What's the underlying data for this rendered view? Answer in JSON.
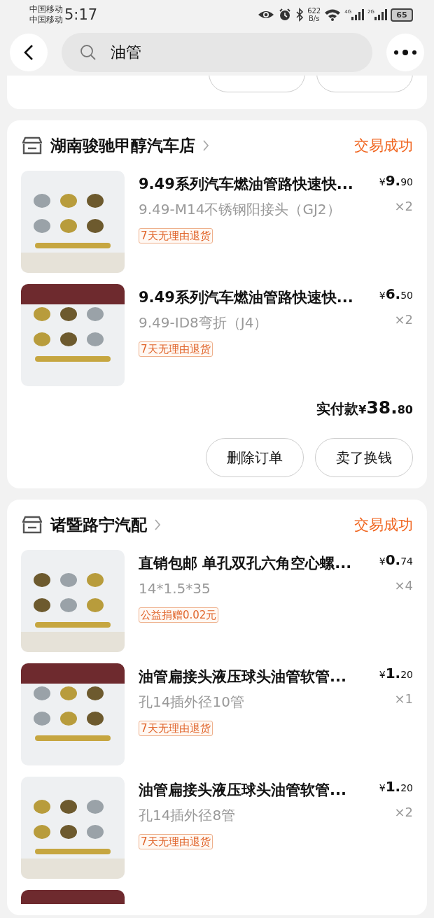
{
  "status_bar": {
    "carriers": [
      "中国移动",
      "中国移动"
    ],
    "time": "5:17",
    "net_speed": [
      "622",
      "B/s"
    ],
    "signals": [
      "4G",
      "2G"
    ],
    "battery": "65"
  },
  "search": {
    "value": "油管"
  },
  "orders": [
    {
      "store": "湖南骏驰甲醇汽车店",
      "status": "交易成功",
      "items": [
        {
          "kind": "item",
          "title": "9.49系列汽车燃油管路快速快...",
          "spec": "9.49-M14不锈钢阳接头（GJ2）",
          "tag": "7天无理由退货",
          "price_symbol": "¥",
          "price_main": "9.",
          "price_fraction": "90",
          "quantity": "×2"
        },
        {
          "kind": "item",
          "title": "9.49系列汽车燃油管路快速快...",
          "spec": "9.49-ID8弯折（J4）",
          "tag": "7天无理由退货",
          "price_symbol": "¥",
          "price_main": "6.",
          "price_fraction": "50",
          "quantity": "×2"
        }
      ],
      "total": {
        "label": "实付款",
        "price_symbol": "¥",
        "price_main": "38.",
        "price_fraction": "80"
      },
      "buttons": [
        "删除订单",
        "卖了换钱"
      ]
    },
    {
      "store": "诸暨路宁汽配",
      "status": "交易成功",
      "items": [
        {
          "kind": "item",
          "title": "直销包邮 单孔双孔六角空心螺...",
          "spec": "14*1.5*35",
          "tag": "公益捐赠0.02元",
          "price_symbol": "¥",
          "price_main": "0.",
          "price_fraction": "74",
          "quantity": "×4"
        },
        {
          "kind": "item",
          "title": "油管扁接头液压球头油管软管...",
          "spec": "孔14插外径10管",
          "tag": "7天无理由退货",
          "price_symbol": "¥",
          "price_main": "1.",
          "price_fraction": "20",
          "quantity": "×1"
        },
        {
          "kind": "item",
          "title": "油管扁接头液压球头油管软管...",
          "spec": "孔14插外径8管",
          "tag": "7天无理由退货",
          "price_symbol": "¥",
          "price_main": "1.",
          "price_fraction": "20",
          "quantity": "×2"
        },
        {
          "kind": "partial"
        }
      ]
    }
  ]
}
